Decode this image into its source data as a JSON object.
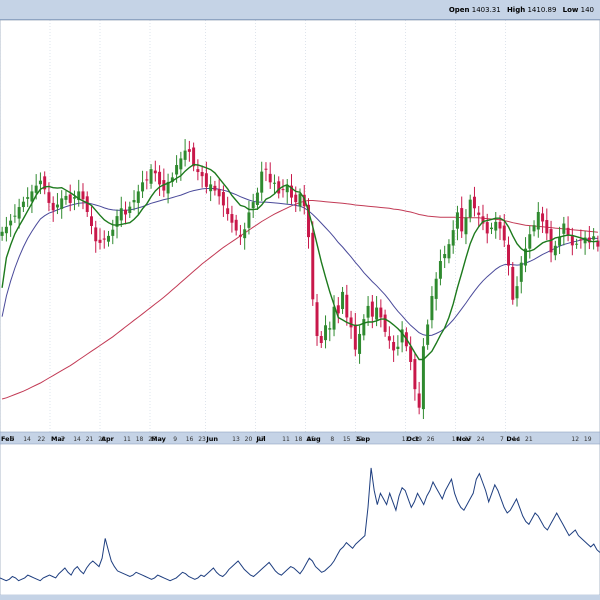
{
  "header": {
    "open_label": "Open",
    "open_value": "1403.31",
    "high_label": "High",
    "high_value": "1410.89",
    "low_label": "Low",
    "low_value": "140"
  },
  "colors": {
    "up": "#2f8a2f",
    "down": "#c8184a",
    "sma_fast": "#1d7a1d",
    "sma_mid": "#4a4a9a",
    "sma_slow": "#c23a55",
    "indicator": "#1f3f80",
    "axis_bg": "#c5d3e6",
    "grid": "#c9d2df"
  },
  "chart_data": [
    {
      "type": "candlestick",
      "x_month_labels": [
        {
          "text": "Feb",
          "day": 0
        },
        {
          "text": "Mar",
          "day": 28
        },
        {
          "text": "Apr",
          "day": 56
        },
        {
          "text": "May",
          "day": 84
        },
        {
          "text": "Jun",
          "day": 115
        },
        {
          "text": "Jul",
          "day": 143
        },
        {
          "text": "Aug",
          "day": 171
        },
        {
          "text": "Sep",
          "day": 199
        },
        {
          "text": "Oct",
          "day": 227
        },
        {
          "text": "Nov",
          "day": 255
        },
        {
          "text": "Dec",
          "day": 283
        }
      ],
      "x_day_labels": [
        {
          "text": "7",
          "day": 6
        },
        {
          "text": "14",
          "day": 13
        },
        {
          "text": "22",
          "day": 21
        },
        {
          "text": "7",
          "day": 34
        },
        {
          "text": "14",
          "day": 41
        },
        {
          "text": "21",
          "day": 48
        },
        {
          "text": "28",
          "day": 55
        },
        {
          "text": "11",
          "day": 69
        },
        {
          "text": "18",
          "day": 76
        },
        {
          "text": "25",
          "day": 83
        },
        {
          "text": "9",
          "day": 97
        },
        {
          "text": "16",
          "day": 104
        },
        {
          "text": "23",
          "day": 111
        },
        {
          "text": "13",
          "day": 130
        },
        {
          "text": "20",
          "day": 137
        },
        {
          "text": "27",
          "day": 144
        },
        {
          "text": "11",
          "day": 158
        },
        {
          "text": "18",
          "day": 165
        },
        {
          "text": "25",
          "day": 172
        },
        {
          "text": "8",
          "day": 185
        },
        {
          "text": "15",
          "day": 192
        },
        {
          "text": "22",
          "day": 199
        },
        {
          "text": "12",
          "day": 225
        },
        {
          "text": "19",
          "day": 232
        },
        {
          "text": "26",
          "day": 239
        },
        {
          "text": "10",
          "day": 253
        },
        {
          "text": "17",
          "day": 260
        },
        {
          "text": "24",
          "day": 267
        },
        {
          "text": "7",
          "day": 280
        },
        {
          "text": "14",
          "day": 287
        },
        {
          "text": "21",
          "day": 294
        },
        {
          "text": "12",
          "day": 320
        },
        {
          "text": "19",
          "day": 327
        }
      ],
      "price_range": [
        0,
        100
      ],
      "closes": [
        48.6,
        49.8,
        51.3,
        52.5,
        54.6,
        55.9,
        57.0,
        58.4,
        59.8,
        61.0,
        58.9,
        55.6,
        53.8,
        55.2,
        56.7,
        57.3,
        55.6,
        57.0,
        58.4,
        56.5,
        53.4,
        50.0,
        46.3,
        45.9,
        46.9,
        47.6,
        49.1,
        52.4,
        54.3,
        52.8,
        54.7,
        56.3,
        58.4,
        60.6,
        61.3,
        63.8,
        62.8,
        60.1,
        58.6,
        60.7,
        61.8,
        64.8,
        66.4,
        68.3,
        68.0,
        64.5,
        63.1,
        62.1,
        59.5,
        60.1,
        58.6,
        57.2,
        55.0,
        52.9,
        50.8,
        48.9,
        47.4,
        49.2,
        53.3,
        55.8,
        58.1,
        63.2,
        63.7,
        60.6,
        60.5,
        57.9,
        58.9,
        59.8,
        56.9,
        55.8,
        57.9,
        54.8,
        47.3,
        32.2,
        23.3,
        21.6,
        25.9,
        25.2,
        30.4,
        28.8,
        34.0,
        27.8,
        25.4,
        20.0,
        23.8,
        27.4,
        30.6,
        28.0,
        30.2,
        27.8,
        24.3,
        22.2,
        19.8,
        20.7,
        24.9,
        20.8,
        17.0,
        10.4,
        5.9,
        20.8,
        26.1,
        33.0,
        37.2,
        41.5,
        43.2,
        45.6,
        49.0,
        53.3,
        48.7,
        52.1,
        56.4,
        54.3,
        52.7,
        50.6,
        48.2,
        49.6,
        51.0,
        49.4,
        46.5,
        40.4,
        32.1,
        35.4,
        41.1,
        44.5,
        48.0,
        50.2,
        53.4,
        51.1,
        48.2,
        43.6,
        45.2,
        47.4,
        50.6,
        47.9,
        45.3,
        45.7,
        46.5,
        47.2,
        46.0,
        47.5,
        45.0
      ],
      "sma_fast": [
        35.0,
        42.3,
        45.4,
        48.1,
        50.0,
        51.8,
        53.7,
        55.5,
        57.5,
        58.9,
        59.5,
        59.6,
        59.3,
        59.2,
        59.3,
        58.7,
        58.1,
        57.4,
        56.6,
        56.1,
        55.6,
        55.0,
        53.8,
        52.6,
        51.5,
        50.8,
        50.3,
        50.2,
        50.4,
        50.6,
        50.8,
        51.6,
        52.7,
        54.2,
        55.4,
        57.1,
        58.5,
        59.5,
        60.0,
        60.4,
        60.9,
        61.6,
        62.2,
        63.3,
        64.2,
        64.9,
        64.8,
        64.5,
        64.1,
        63.7,
        62.9,
        61.6,
        60.3,
        59.0,
        57.4,
        56.2,
        55.0,
        54.7,
        54.0,
        54.0,
        54.1,
        55.1,
        56.5,
        57.0,
        57.8,
        58.9,
        59.6,
        60.0,
        59.2,
        58.4,
        58.2,
        56.7,
        53.6,
        49.8,
        45.6,
        41.3,
        37.6,
        34.0,
        30.9,
        27.8,
        27.2,
        26.6,
        26.2,
        25.8,
        26.0,
        26.4,
        26.7,
        26.7,
        27.0,
        27.4,
        27.4,
        26.8,
        26.0,
        25.1,
        24.0,
        22.6,
        21.0,
        19.2,
        17.6,
        17.6,
        18.6,
        19.6,
        21.5,
        23.5,
        25.3,
        27.8,
        31.1,
        35.0,
        38.6,
        42.3,
        45.7,
        48.2,
        49.8,
        51.1,
        51.3,
        51.6,
        51.9,
        51.9,
        51.3,
        49.8,
        47.6,
        45.7,
        44.5,
        43.8,
        43.9,
        44.3,
        45.1,
        45.9,
        46.3,
        46.5,
        47.1,
        47.3,
        47.6,
        47.8,
        47.7,
        47.4,
        47.1,
        46.8,
        46.3,
        46.2,
        46.3
      ],
      "sma_mid": [
        28.0,
        33.0,
        36.6,
        39.8,
        42.5,
        44.9,
        47.0,
        48.7,
        50.3,
        51.7,
        52.5,
        53.1,
        53.5,
        53.9,
        54.3,
        54.7,
        55.0,
        55.3,
        55.5,
        55.6,
        55.6,
        55.4,
        55.1,
        54.8,
        54.4,
        54.1,
        53.9,
        53.8,
        53.8,
        53.8,
        53.9,
        54.1,
        54.4,
        54.7,
        55.1,
        55.5,
        55.8,
        56.1,
        56.4,
        56.6,
        56.9,
        57.2,
        57.5,
        57.9,
        58.3,
        58.6,
        58.8,
        59.0,
        59.1,
        59.1,
        59.1,
        58.9,
        58.7,
        58.4,
        58.0,
        57.6,
        57.1,
        56.7,
        56.3,
        56.0,
        55.8,
        55.8,
        55.8,
        55.7,
        55.6,
        55.5,
        55.4,
        55.3,
        55.2,
        55.0,
        54.8,
        54.4,
        53.7,
        52.8,
        51.8,
        50.7,
        49.6,
        48.5,
        47.3,
        46.0,
        44.9,
        43.7,
        42.5,
        41.2,
        40.0,
        38.7,
        37.6,
        36.5,
        35.5,
        34.4,
        33.3,
        32.0,
        30.6,
        29.3,
        28.2,
        27.0,
        25.9,
        25.0,
        24.1,
        23.6,
        23.4,
        23.5,
        23.9,
        24.4,
        25.1,
        26.1,
        27.2,
        28.5,
        29.9,
        31.3,
        32.8,
        34.2,
        35.5,
        36.7,
        37.7,
        38.6,
        39.5,
        40.2,
        40.6,
        40.7,
        40.6,
        40.5,
        40.6,
        41.0,
        41.4,
        41.9,
        42.5,
        43.1,
        43.6,
        44.1,
        44.6,
        45.1,
        45.5,
        45.8,
        46.1,
        46.3,
        46.6,
        46.8,
        46.9,
        47.0,
        47.0
      ],
      "sma_slow": [
        8.0,
        8.3,
        8.7,
        9.1,
        9.5,
        9.9,
        10.4,
        10.9,
        11.4,
        11.9,
        12.5,
        13.1,
        13.7,
        14.3,
        14.9,
        15.5,
        16.1,
        16.8,
        17.5,
        18.2,
        18.9,
        19.6,
        20.3,
        21.0,
        21.7,
        22.4,
        23.1,
        23.9,
        24.7,
        25.5,
        26.3,
        27.1,
        27.9,
        28.7,
        29.5,
        30.3,
        31.1,
        31.9,
        32.7,
        33.6,
        34.5,
        35.4,
        36.3,
        37.2,
        38.1,
        39.0,
        39.9,
        40.8,
        41.6,
        42.4,
        43.2,
        44.0,
        44.8,
        45.5,
        46.2,
        46.9,
        47.6,
        48.3,
        49.0,
        49.7,
        50.4,
        51.1,
        51.7,
        52.3,
        52.9,
        53.4,
        53.9,
        54.4,
        54.9,
        55.3,
        55.7,
        56.0,
        56.2,
        56.2,
        56.1,
        56.0,
        55.9,
        55.8,
        55.7,
        55.6,
        55.5,
        55.4,
        55.3,
        55.1,
        55.0,
        54.9,
        54.8,
        54.7,
        54.6,
        54.5,
        54.4,
        54.3,
        54.1,
        54.0,
        53.8,
        53.6,
        53.4,
        53.1,
        52.8,
        52.6,
        52.4,
        52.3,
        52.2,
        52.1,
        52.1,
        52.1,
        52.1,
        52.1,
        52.0,
        52.0,
        52.0,
        52.0,
        52.0,
        51.9,
        51.8,
        51.7,
        51.6,
        51.5,
        51.3,
        51.1,
        50.8,
        50.6,
        50.4,
        50.2,
        50.1,
        50.0,
        49.9,
        49.8,
        49.7,
        49.6,
        49.5,
        49.4,
        49.3,
        49.2,
        49.1,
        49.0,
        48.9,
        48.8,
        48.7,
        48.6,
        48.5
      ]
    },
    {
      "type": "line",
      "name": "",
      "y_range": [
        0,
        100
      ],
      "values": [
        10,
        9,
        8,
        9,
        11,
        10,
        8,
        9,
        10,
        12,
        11,
        10,
        9,
        8,
        10,
        11,
        12,
        11,
        10,
        13,
        15,
        17,
        14,
        12,
        16,
        18,
        15,
        13,
        17,
        20,
        22,
        20,
        18,
        24,
        38,
        30,
        22,
        18,
        15,
        14,
        13,
        12,
        11,
        12,
        14,
        13,
        12,
        11,
        10,
        9,
        10,
        12,
        11,
        10,
        9,
        8,
        9,
        10,
        12,
        14,
        13,
        11,
        10,
        9,
        10,
        12,
        11,
        13,
        15,
        17,
        14,
        12,
        11,
        13,
        16,
        18,
        20,
        22,
        19,
        16,
        14,
        12,
        11,
        13,
        15,
        17,
        19,
        21,
        18,
        15,
        13,
        12,
        14,
        16,
        18,
        17,
        15,
        13,
        16,
        20,
        24,
        22,
        18,
        16,
        14,
        15,
        17,
        19,
        22,
        26,
        30,
        32,
        35,
        33,
        31,
        34,
        36,
        38,
        40,
        60,
        88,
        72,
        62,
        70,
        66,
        62,
        70,
        64,
        58,
        68,
        74,
        72,
        66,
        60,
        64,
        70,
        66,
        62,
        68,
        72,
        78,
        74,
        70,
        66,
        72,
        76,
        80,
        70,
        64,
        60,
        58,
        62,
        66,
        70,
        80,
        84,
        78,
        72,
        64,
        70,
        76,
        72,
        66,
        60,
        56,
        58,
        62,
        66,
        60,
        54,
        50,
        48,
        52,
        56,
        54,
        50,
        46,
        44,
        48,
        52,
        56,
        52,
        48,
        44,
        40,
        42,
        44,
        40,
        38,
        36,
        34,
        32,
        34,
        30,
        28
      ]
    }
  ]
}
